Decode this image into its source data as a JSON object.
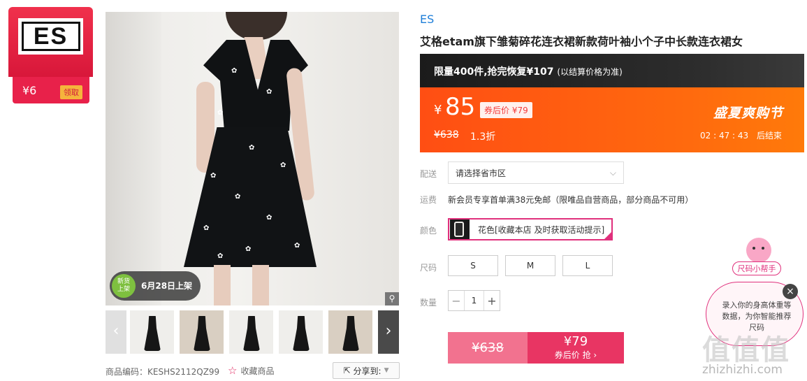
{
  "brand_card": {
    "logo_text": "ES",
    "coupon_amount": "¥6",
    "claim_label": "领取"
  },
  "gallery": {
    "new_badge": "新货上架",
    "launch_date": "6月28日上架",
    "thumbnail_count": 5
  },
  "meta": {
    "sku": "商品编码：KESHS2112QZ99",
    "favorite_label": "收藏商品",
    "share_label": "分享到:"
  },
  "product": {
    "brand": "ES",
    "title": "艾格etam旗下雏菊碎花连衣裙新款荷叶袖小个子中长款连衣裙女"
  },
  "promo": {
    "banner_main": "限量400件,抢完恢复¥107",
    "banner_note": "(以结算价格为准)",
    "currency": "¥",
    "price": "85",
    "after_coupon": "券后价 ¥79",
    "original_price": "¥638",
    "discount": "1.3折",
    "festival": "盛夏爽购节",
    "countdown": "02 : 47 : 43",
    "countdown_suffix": "后结束"
  },
  "delivery": {
    "label": "配送",
    "placeholder": "请选择省市区"
  },
  "freight": {
    "label": "运费",
    "text": "新会员专享首单满38元免邮（限唯品自营商品，部分商品不可用）"
  },
  "color": {
    "label": "颜色",
    "option": "花色[收藏本店 及时获取活动提示]"
  },
  "size": {
    "label": "尺码",
    "options": [
      "S",
      "M",
      "L"
    ]
  },
  "quantity": {
    "label": "数量",
    "value": "1",
    "minus": "−",
    "plus": "+"
  },
  "buy": {
    "original": "¥638",
    "coupon_price": "¥79",
    "coupon_action": "券后价 抢 ›"
  },
  "size_helper": {
    "label": "尺码小帮手",
    "text": "录入你的身高体重等数据，为你智能推荐尺码",
    "close": "×"
  },
  "watermark": {
    "logo": "值值值",
    "url": "zhizhizhi.com"
  }
}
